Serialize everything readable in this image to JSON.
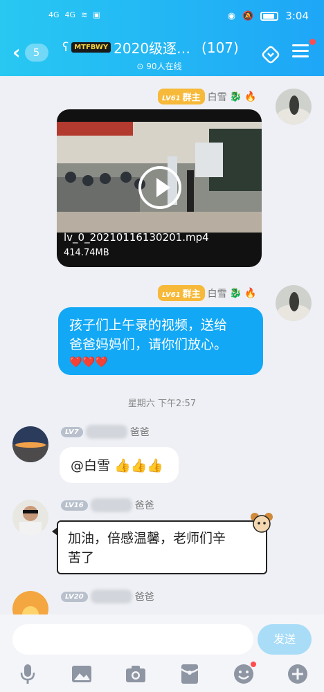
{
  "status_bar": {
    "signal_1": "4G",
    "signal_2": "4G",
    "time": "3:04"
  },
  "header": {
    "unread_count": "5",
    "brand_badge": "MTFBWY",
    "group_title": "2020级逐…",
    "member_count": "(107)",
    "online": "90人在线"
  },
  "messages": {
    "m1": {
      "level": "LV61",
      "role": "群主",
      "sender": "白雪",
      "video_name": "lv_0_20210116130201.mp4",
      "video_size": "414.74MB"
    },
    "m2": {
      "level": "LV61",
      "role": "群主",
      "sender": "白雪",
      "text_line1": "孩子们上午录的视频，送给",
      "text_line2": "爸爸妈妈们，请你们放心。",
      "hearts": "❤️❤️❤️"
    },
    "time_separator": "星期六 下午2:57",
    "m3": {
      "level": "LV7",
      "sender_suffix": "爸爸",
      "text": "@白雪 👍👍👍"
    },
    "m4": {
      "level": "LV16",
      "sender_suffix": "爸爸",
      "text_line1": "加油，倍感温馨，老师们辛",
      "text_line2": "苦了"
    },
    "m5": {
      "level": "LV20",
      "sender_suffix": "爸爸"
    }
  },
  "input": {
    "placeholder": "",
    "send_label": "发送"
  },
  "colors": {
    "header_start": "#28c8f2",
    "header_end": "#1ea6f7",
    "bubble_blue": "#12a8f5",
    "owner_badge": "#f7b93a"
  },
  "icons": [
    "voice-icon",
    "image-icon",
    "camera-icon",
    "red-packet-icon",
    "emoji-icon",
    "plus-icon"
  ]
}
